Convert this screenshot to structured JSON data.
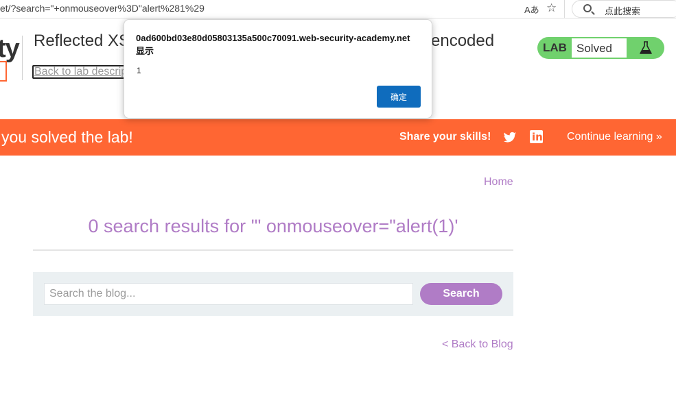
{
  "browser": {
    "url": "et/?search=\"+onmouseover%3D\"alert%281%29",
    "read_aloud_icon": "Aあ",
    "search_placeholder": "点此搜索"
  },
  "header": {
    "logo_text": "ty",
    "title_start": "Reflected XS",
    "title_end": "-encoded",
    "back_link": "Back to lab description",
    "status_label": "LAB",
    "status_value": "Solved"
  },
  "banner": {
    "message": "you solved the lab!",
    "share_label": "Share your skills!",
    "continue_label": "Continue learning »"
  },
  "page": {
    "home_link": "Home",
    "results_heading": "0 search results for '\" onmouseover=\"alert(1)'",
    "search_placeholder": "Search the blog...",
    "search_button": "Search",
    "back_to_blog": "< Back to Blog"
  },
  "alert_dialog": {
    "origin_text": "0ad600bd03e80d05803135a500c70091.web-security-academy.net 显示",
    "message": "1",
    "ok_button": "确定"
  },
  "colors": {
    "accent_purple": "#b07cc6",
    "banner_orange": "#ff6633",
    "status_green": "#70d16d",
    "dialog_button_blue": "#0f6cbd"
  }
}
